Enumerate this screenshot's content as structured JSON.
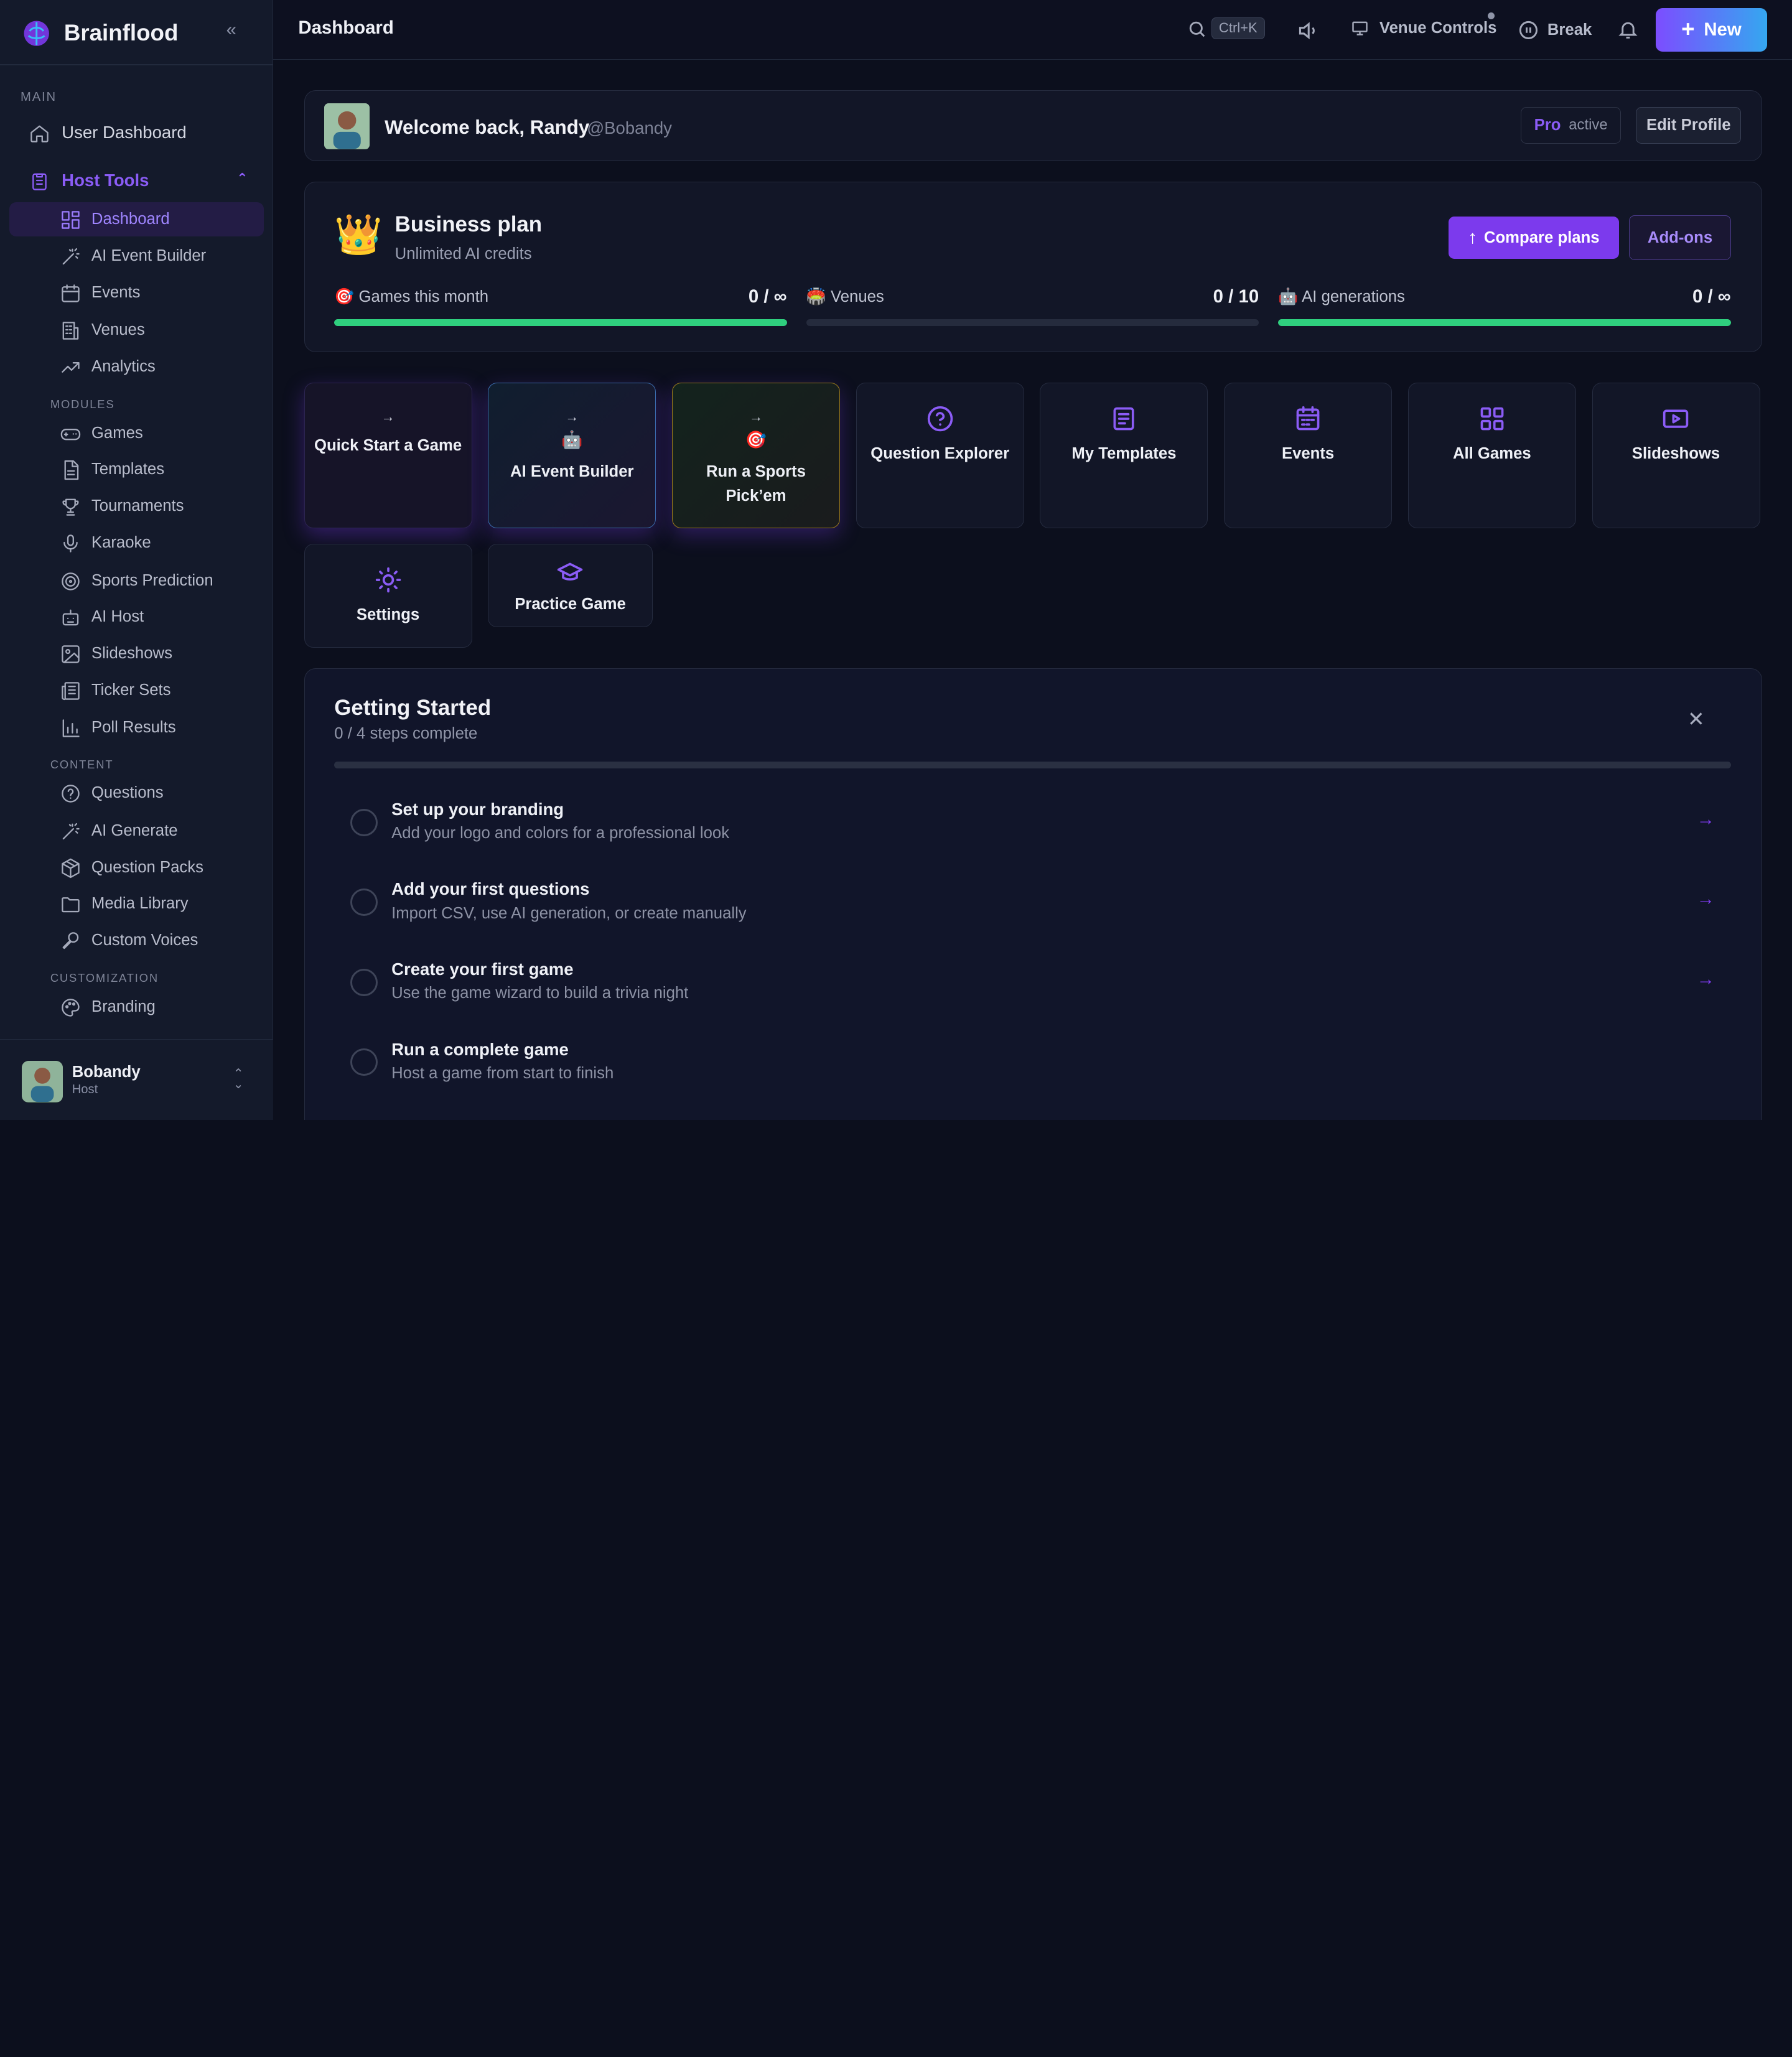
{
  "app": {
    "name": "Brainflood"
  },
  "sidebar": {
    "main_label": "MAIN",
    "user_dashboard": "User Dashboard",
    "host_tools": "Host Tools",
    "host_items": [
      "Dashboard",
      "AI Event Builder",
      "Events",
      "Venues",
      "Analytics"
    ],
    "modules_label": "MODULES",
    "modules": [
      "Games",
      "Templates",
      "Tournaments",
      "Karaoke",
      "Sports Prediction",
      "AI Host",
      "Slideshows",
      "Ticker Sets",
      "Poll Results"
    ],
    "content_label": "CONTENT",
    "content": [
      "Questions",
      "AI Generate",
      "Question Packs",
      "Media Library",
      "Custom Voices"
    ],
    "customization_label": "CUSTOMIZATION",
    "customization": [
      "Branding"
    ],
    "user": {
      "name": "Bobandy",
      "role": "Host"
    }
  },
  "topbar": {
    "title": "Dashboard",
    "shortcut": "Ctrl+K",
    "venue_controls": "Venue Controls",
    "break": "Break",
    "new": "New"
  },
  "welcome": {
    "text": "Welcome back, Randy",
    "handle": "@Bobandy",
    "plan_badge": "Pro",
    "status": "active",
    "edit": "Edit Profile"
  },
  "plan": {
    "icon": "👑",
    "name": "Business plan",
    "subtitle": "Unlimited AI credits",
    "compare": "Compare plans",
    "addons": "Add-ons",
    "usage": [
      {
        "emoji": "🎯",
        "label": "Games this month",
        "value": "0 / ∞",
        "fill": 1.0
      },
      {
        "emoji": "🏟️",
        "label": "Venues",
        "value": "0 / 10",
        "fill": 0.0
      },
      {
        "emoji": "🤖",
        "label": "AI generations",
        "value": "0 / ∞",
        "fill": 1.0
      }
    ]
  },
  "quick_actions": [
    {
      "label": "Quick Start a Game",
      "arrow": "→"
    },
    {
      "label": "AI Event Builder",
      "arrow": "→",
      "emoji": "🤖"
    },
    {
      "label": "Run a Sports Pick’em",
      "arrow": "→",
      "emoji": "🎯"
    },
    {
      "label": "Question Explorer",
      "icon": "question-circle-icon"
    },
    {
      "label": "My Templates",
      "icon": "document-icon"
    },
    {
      "label": "Events",
      "icon": "calendar-icon"
    },
    {
      "label": "All Games",
      "icon": "grid-icon"
    },
    {
      "label": "Slideshows",
      "icon": "play-icon"
    },
    {
      "label": "Settings",
      "icon": "sun-gear-icon"
    },
    {
      "label": "Practice Game",
      "icon": "graduation-cap-icon"
    }
  ],
  "getting_started": {
    "title": "Getting Started",
    "progress": "0 / 4 steps complete",
    "close": "✕",
    "steps": [
      {
        "title": "Set up your branding",
        "desc": "Add your logo and colors for a professional look"
      },
      {
        "title": "Add your first questions",
        "desc": "Import CSV, use AI generation, or create manually"
      },
      {
        "title": "Create your first game",
        "desc": "Use the game wizard to build a trivia night"
      },
      {
        "title": "Run a complete game",
        "desc": "Host a game from start to finish"
      }
    ]
  },
  "colors": {
    "accent": "#7c3aed",
    "success": "#2fcf7e",
    "background": "#0c0f1d"
  }
}
